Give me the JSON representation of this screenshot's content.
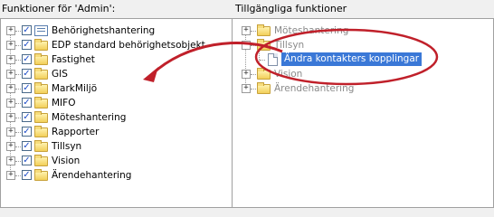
{
  "left_panel": {
    "title": "Funktioner för 'Admin':",
    "items": [
      {
        "label": "Behörighetshantering",
        "icon": "list-icon"
      },
      {
        "label": "EDP standard behörighetsobjekt",
        "icon": "folder-icon"
      },
      {
        "label": "Fastighet",
        "icon": "folder-icon"
      },
      {
        "label": "GIS",
        "icon": "folder-icon"
      },
      {
        "label": "MarkMiljö",
        "icon": "folder-icon"
      },
      {
        "label": "MIFO",
        "icon": "folder-icon"
      },
      {
        "label": "Möteshantering",
        "icon": "folder-icon"
      },
      {
        "label": "Rapporter",
        "icon": "folder-icon"
      },
      {
        "label": "Tillsyn",
        "icon": "folder-icon"
      },
      {
        "label": "Vision",
        "icon": "folder-icon"
      },
      {
        "label": "Ärendehantering",
        "icon": "folder-icon"
      }
    ]
  },
  "right_panel": {
    "title": "Tillgängliga funktioner",
    "items": [
      {
        "label": "Möteshantering",
        "expander": "+"
      },
      {
        "label": "Tillsyn",
        "expander": "−"
      },
      {
        "label": "Ändra kontakters kopplingar",
        "selected": true
      },
      {
        "label": "Vision",
        "expander": "+"
      },
      {
        "label": "Ärendehantering",
        "expander": "+"
      }
    ]
  },
  "annotation": {
    "color": "#c0202a",
    "arrow_icon": "curved-arrow-icon",
    "highlight_icon": "ellipse-highlight-icon"
  }
}
